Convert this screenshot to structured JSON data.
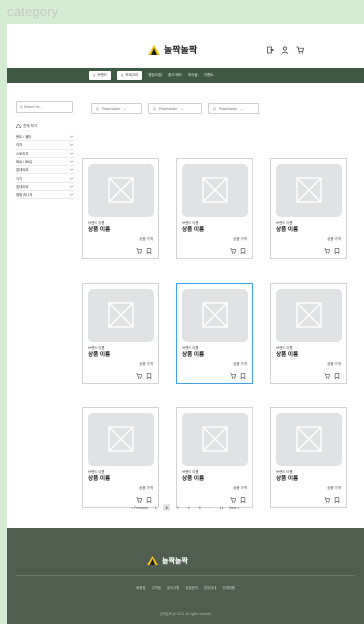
{
  "frame": {
    "title": "category"
  },
  "header": {
    "logo_text": "놀짝놀짝",
    "icons": [
      "login-icon",
      "user-icon",
      "cart-icon"
    ]
  },
  "nav": {
    "brand_button": "브랜드",
    "category_button": "카테고리",
    "links": [
      "랭킹/리뷰",
      "중고 매도",
      "마이샵",
      "이벤트"
    ]
  },
  "sidebar": {
    "search_placeholder": "Q Search for...",
    "view_all": "전체 보기",
    "categories": [
      {
        "label": "텐트 / 쉘터"
      },
      {
        "label": "의자"
      },
      {
        "label": "스토리지"
      },
      {
        "label": "화로 / BBQ"
      },
      {
        "label": "침대야외"
      },
      {
        "label": "식기"
      },
      {
        "label": "침대야외"
      },
      {
        "label": "캠핑 하나자"
      }
    ]
  },
  "filters": [
    {
      "label": "Placeholder"
    },
    {
      "label": "Placeholder"
    },
    {
      "label": "Placeholder"
    }
  ],
  "products": [
    {
      "brand": "브랜드 이름",
      "name": "상품 이름",
      "price": "상품 가격",
      "selected": false
    },
    {
      "brand": "브랜드 이름",
      "name": "상품 이름",
      "price": "상품 가격",
      "selected": false
    },
    {
      "brand": "브랜드 이름",
      "name": "상품 이름",
      "price": "상품 가격",
      "selected": false
    },
    {
      "brand": "브랜드 이름",
      "name": "상품 이름",
      "price": "상품 가격",
      "selected": false
    },
    {
      "brand": "브랜드 이름",
      "name": "상품 이름",
      "price": "상품 가격",
      "selected": true
    },
    {
      "brand": "브랜드 이름",
      "name": "상품 이름",
      "price": "상품 가격",
      "selected": false
    },
    {
      "brand": "브랜드 이름",
      "name": "상품 이름",
      "price": "상품 가격",
      "selected": false
    },
    {
      "brand": "브랜드 이름",
      "name": "상품 이름",
      "price": "상품 가격",
      "selected": false
    },
    {
      "brand": "브랜드 이름",
      "name": "상품 이름",
      "price": "상품 가격",
      "selected": false
    }
  ],
  "pagination": {
    "previous": "< Previous",
    "pages": [
      "1",
      "2",
      "3",
      "4",
      "5",
      "...",
      "11"
    ],
    "active": "2",
    "next": "Next >"
  },
  "footer": {
    "logo_text": "놀짝놀짝",
    "links": [
      "회원정",
      "고객셈",
      "공지사항",
      "입점문의",
      "업무안내",
      "인재채용"
    ],
    "copyright": "놀짝놀짝 @ 2023. All rights reserved"
  },
  "colors": {
    "frame_bg": "#d4ecd2",
    "nav_bg": "#3f5a43",
    "footer_bg": "#505e4f",
    "selected_border": "#3ea0e8",
    "logo_yellow": "#f2c20b"
  }
}
